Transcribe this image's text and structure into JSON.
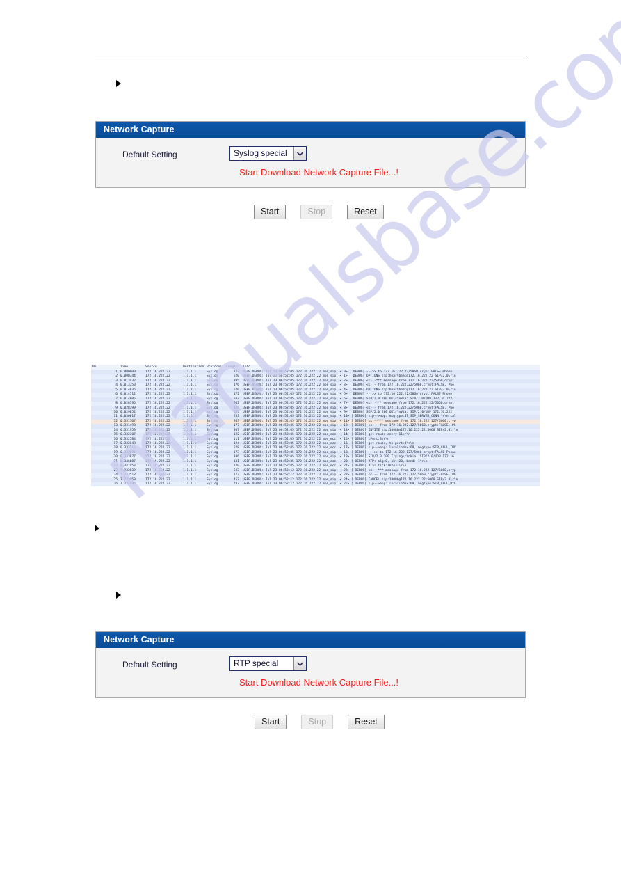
{
  "watermark": {
    "text": "manualsbase.com"
  },
  "panels": [
    {
      "title": "Network Capture",
      "field_label": "Default Setting",
      "select_value": "Syslog special",
      "status_message": "Start Download Network Capture File...!",
      "buttons": [
        {
          "label": "Start",
          "disabled": false
        },
        {
          "label": "Stop",
          "disabled": true
        },
        {
          "label": "Reset",
          "disabled": false
        }
      ]
    },
    {
      "title": "Network Capture",
      "field_label": "Default Setting",
      "select_value": "RTP special",
      "status_message": "Start Download Network Capture File...!",
      "buttons": [
        {
          "label": "Start",
          "disabled": false
        },
        {
          "label": "Stop",
          "disabled": true
        },
        {
          "label": "Reset",
          "disabled": false
        }
      ]
    }
  ],
  "colors": {
    "panel_header_blue": "#0a4f9e",
    "status_red": "#ff1a1a",
    "select_border": "#1f2f6e",
    "capture_row": "#dde7f7",
    "capture_row_alt": "#e6eefb",
    "capture_row_highlight": "#f7e9dd",
    "watermark": "#c9cbee"
  },
  "capture": {
    "columns": [
      "No.",
      "Time",
      "Source",
      "Destination",
      "Protocol",
      "Length",
      "Info"
    ],
    "rows": [
      {
        "no": "1",
        "time": "0.000000",
        "src": "172.16.222.22",
        "dst": "1.1.1.1",
        "proto": "Syslog",
        "len": "172",
        "info": "USER.DEBUG: Jul 23 06:52:05 172.16.222.22 mpe_sip: <  0> [    DEBUG] --->> to 172.16.222.22/5060 crypt:FALSE Phone"
      },
      {
        "no": "2",
        "time": "0.000344",
        "src": "172.16.222.22",
        "dst": "1.1.1.1",
        "proto": "Syslog",
        "len": "520",
        "info": "USER.DEBUG: Jul 23 06:52:05 172.16.222.22 mpe_sip: <  1> [    DEBUG] OPTIONS sip:heartbeat@172.16.222.22 SIP/2.0\\r\\n"
      },
      {
        "no": "3",
        "time": "0.013432",
        "src": "172.16.222.22",
        "dst": "1.1.1.1",
        "proto": "Syslog",
        "len": "395",
        "info": "USER.DEBUG: Jul 23 06:52:05 172.16.222.22 mpe_sip: <  2> [    DEBUG] <<---*** message from 172.16.222.22/5060,crypt"
      },
      {
        "no": "4",
        "time": "0.013750",
        "src": "172.16.222.22",
        "dst": "1.1.1.1",
        "proto": "Syslog",
        "len": "176",
        "info": "USER.DEBUG: Jul 23 06:52:05 172.16.222.22 mpe_sip: <  3> [    DEBUG] <<--- from 172.16.222.22/5060,crypt:FALSE, Pho"
      },
      {
        "no": "5",
        "time": "0.014036",
        "src": "172.16.222.22",
        "dst": "1.1.1.1",
        "proto": "Syslog",
        "len": "520",
        "info": "USER.DEBUG: Jul 23 06:52:05 172.16.222.22 mpe_sip: <  4> [    DEBUG] OPTIONS sip:heartbeat@172.16.222.22 SIP/2.0\\r\\n"
      },
      {
        "no": "6",
        "time": "0.014512",
        "src": "172.16.222.22",
        "dst": "1.1.1.1",
        "proto": "Syslog",
        "len": "172",
        "info": "USER.DEBUG: Jul 23 06:52:05 172.16.222.22 mpe_sip: <  5> [    DEBUG] --->> to 172.16.222.22/5060 crypt:FALSE Phone"
      },
      {
        "no": "7",
        "time": "0.014806",
        "src": "172.16.222.22",
        "dst": "1.1.1.1",
        "proto": "Syslog",
        "len": "587",
        "info": "USER.DEBUG: Jul 23 06:52:05 172.16.222.22 mpe_sip: <  6> [    DEBUG] SIP/2.0 200 OK\\r\\nVia: SIP/2.0/UDP 172.16.222."
      },
      {
        "no": "8",
        "time": "0.028396",
        "src": "172.16.222.22",
        "dst": "1.1.1.1",
        "proto": "Syslog",
        "len": "662",
        "info": "USER.DEBUG: Jul 23 06:52:05 172.16.222.22 mpe_sip: <  7> [    DEBUG] <<---*** message from 172.16.222.22/5060,crypt"
      },
      {
        "no": "9",
        "time": "0.028799",
        "src": "172.16.222.22",
        "dst": "1.1.1.1",
        "proto": "Syslog",
        "len": "176",
        "info": "USER.DEBUG: Jul 23 06:52:05 172.16.222.22 mpe_sip: <  8> [    DEBUG] <<--- from 172.16.222.22/5060,crypt:FALSE, Pho"
      },
      {
        "no": "10",
        "time": "0.029052",
        "src": "172.16.222.22",
        "dst": "1.1.1.1",
        "proto": "Syslog",
        "len": "587",
        "info": "USER.DEBUG: Jul 23 06:52:05 172.16.222.22 mpe_sip: <  9> [    DEBUG] SIP/2.0 200 OK\\r\\nVia: SIP/2.0/UDP 172.16.222."
      },
      {
        "no": "11",
        "time": "0.030017",
        "src": "172.16.222.22",
        "dst": "1.1.1.1",
        "proto": "Syslog",
        "len": "233",
        "info": "USER.DEBUG: Jul 23 06:52:05 172.16.222.22 mpe_sip: < 10> [    DEBUG] sip-->app: msgtype:ST_SIP_SERVER_CONN \\r\\n cal"
      },
      {
        "no": "12",
        "time": "0.331167",
        "src": "172.16.222.22",
        "dst": "1.1.1.1",
        "proto": "Syslog",
        "len": "983",
        "info": "USER.DEBUG: Jul 23 06:52:05 172.16.222.22 mpe_sip: < 11> [    DEBUG] <<---*** message from 172.16.222.127/5060,cryp",
        "highlight": true
      },
      {
        "no": "13",
        "time": "0.331498",
        "src": "172.16.222.22",
        "dst": "1.1.1.1",
        "proto": "Syslog",
        "len": "177",
        "info": "USER.DEBUG: Jul 23 06:52:05 172.16.222.22 mpe_sip: < 12> [    DEBUG] <<--- from 172.16.222.127/5060,crypt:FALSE, Ph"
      },
      {
        "no": "14",
        "time": "0.331959",
        "src": "172.16.222.22",
        "dst": "1.1.1.1",
        "proto": "Syslog",
        "len": "907",
        "info": "USER.DEBUG: Jul 23 06:52:05 172.16.222.22 mpe_sip: < 13> [    DEBUG] INVITE sip:10086@172.16.222.22:5060 SIP/2.0\\r\\n"
      },
      {
        "no": "15",
        "time": "0.332307",
        "src": "172.16.222.22",
        "dst": "1.1.1.1",
        "proto": "Syslog",
        "len": "122",
        "info": "USER.DEBUG: Jul 23 06:52:05 172.16.222.22 mpe_ecc: < 14> [    DEBUG] get route entry 11\\r\\n"
      },
      {
        "no": "16",
        "time": "0.332584",
        "src": "172.16.222.22",
        "dst": "1.1.1.1",
        "proto": "Syslog",
        "len": "111",
        "info": "USER.DEBUG: Jul 23 06:52:05 172.16.222.22 mpe_ecc: < 15> [    DEBUG] lPort:3\\r\\n"
      },
      {
        "no": "17",
        "time": "0.332848",
        "src": "172.16.222.22",
        "dst": "1.1.1.1",
        "proto": "Syslog",
        "len": "124",
        "info": "USER.DEBUG: Jul 23 06:52:05 172.16.222.22 mpe_ecc: < 16> [    DEBUG] get route, to port:3\\r\\n"
      },
      {
        "no": "18",
        "time": "0.333315",
        "src": "172.16.222.22",
        "dst": "1.1.1.1",
        "proto": "Syslog",
        "len": "528",
        "info": "USER.DEBUG: Jul 23 06:52:05 172.16.222.22 mpe_ecc: < 17> [    DEBUG] sip-->app: localindex:69, msgtype:SIP_CALL_INV"
      },
      {
        "no": "19",
        "time": "0.333601",
        "src": "172.16.222.22",
        "dst": "1.1.1.1",
        "proto": "Syslog",
        "len": "173",
        "info": "USER.DEBUG: Jul 23 06:52:05 172.16.222.22 mpe_sip: < 18> [    DEBUG] --->> to 172.16.222.127/5060 crypt:FALSE Phone"
      },
      {
        "no": "20",
        "time": "0.333877",
        "src": "172.16.222.22",
        "dst": "1.1.1.1",
        "proto": "Syslog",
        "len": "386",
        "info": "USER.DEBUG: Jul 23 06:52:05 172.16.222.22 mpe_sip: < 19> [    DEBUG] SIP/2.0 100 Trying\\r\\nVia: SIP/2.0/UDP 172.16."
      },
      {
        "no": "21",
        "time": "0.346687",
        "src": "172.16.222.22",
        "dst": "1.1.1.1",
        "proto": "Syslog",
        "len": "131",
        "info": "USER.DEBUG: Jul 23 06:52:05 172.16.222.22 mpe_ecc: < 20> [    DEBUG] RTP: alg:0, pkt:20, band:-1\\r\\n"
      },
      {
        "no": "22",
        "time": "0.347453",
        "src": "172.16.222.22",
        "dst": "1.1.1.1",
        "proto": "Syslog",
        "len": "120",
        "info": "USER.DEBUG: Jul 23 06:52:05 172.16.222.22 mpe_ecc: < 21> [    DEBUG] dial tick:102433\\r\\n"
      },
      {
        "no": "23",
        "time": "7.232839",
        "src": "172.16.222.22",
        "dst": "1.1.1.1",
        "proto": "Syslog",
        "len": "533",
        "info": "USER.DEBUG: Jul 23 06:52:12 172.16.222.22 mpe_sip: < 22> [    DEBUG] <<---*** message from 172.16.222.127/5060,cryp"
      },
      {
        "no": "24",
        "time": "7.233513",
        "src": "172.16.222.22",
        "dst": "1.1.1.1",
        "proto": "Syslog",
        "len": "177",
        "info": "USER.DEBUG: Jul 23 06:52:12 172.16.222.22 mpe_sip: < 23> [    DEBUG] <<--- from 172.16.222.127/5060,crypt:FALSE, Ph"
      },
      {
        "no": "25",
        "time": "7.233959",
        "src": "172.16.222.22",
        "dst": "1.1.1.1",
        "proto": "Syslog",
        "len": "457",
        "info": "USER.DEBUG: Jul 23 06:52:12 172.16.222.22 mpe_sip: < 24> [    DEBUG] CANCEL sip:10086@172.16.222.22:5060 SIP/2.0\\r\\n"
      },
      {
        "no": "26",
        "time": "7.234596",
        "src": "172.16.222.22",
        "dst": "1.1.1.1",
        "proto": "Syslog",
        "len": "287",
        "info": "USER.DEBUG: Jul 23 06:52:12 172.16.222.22 mpe_sip: < 25> [    DEBUG] sip-->app: localindex:69, msgtype:SIP_CALL_BYE"
      }
    ]
  }
}
